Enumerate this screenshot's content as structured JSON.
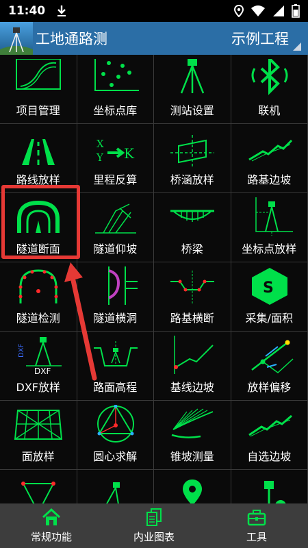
{
  "status": {
    "time": "11:40"
  },
  "appbar": {
    "title": "工地通路测",
    "project": "示例工程"
  },
  "grid": {
    "items": [
      {
        "label": "项目管理",
        "icon": "project-management-icon"
      },
      {
        "label": "坐标点库",
        "icon": "coordinate-points-icon"
      },
      {
        "label": "测站设置",
        "icon": "tripod-icon"
      },
      {
        "label": "联机",
        "icon": "bluetooth-icon"
      },
      {
        "label": "路线放样",
        "icon": "road-icon"
      },
      {
        "label": "里程反算",
        "icon": "xy-to-k-icon"
      },
      {
        "label": "桥涵放样",
        "icon": "culvert-icon"
      },
      {
        "label": "路基边坡",
        "icon": "slope-icon"
      },
      {
        "label": "隧道断面",
        "icon": "tunnel-section-icon"
      },
      {
        "label": "隧道仰坡",
        "icon": "tunnel-slope-icon"
      },
      {
        "label": "桥梁",
        "icon": "bridge-icon"
      },
      {
        "label": "坐标点放样",
        "icon": "point-stakeout-icon"
      },
      {
        "label": "隧道检测",
        "icon": "tunnel-check-icon"
      },
      {
        "label": "隧道横洞",
        "icon": "tunnel-cross-icon"
      },
      {
        "label": "路基横断",
        "icon": "roadbed-cross-icon"
      },
      {
        "label": "采集/面积",
        "icon": "collect-area-icon"
      },
      {
        "label": "DXF放样",
        "icon": "dxf-icon"
      },
      {
        "label": "路面高程",
        "icon": "elevation-icon"
      },
      {
        "label": "基线边坡",
        "icon": "baseline-slope-icon"
      },
      {
        "label": "放样偏移",
        "icon": "offset-icon"
      },
      {
        "label": "面放样",
        "icon": "surface-icon"
      },
      {
        "label": "圆心求解",
        "icon": "circle-center-icon"
      },
      {
        "label": "锥坡测量",
        "icon": "cone-slope-icon"
      },
      {
        "label": "自选边坡",
        "icon": "custom-slope-icon"
      },
      {
        "label": "",
        "icon": "triangle-net-icon"
      },
      {
        "label": "",
        "icon": "instrument-icon"
      },
      {
        "label": "",
        "icon": "map-pin-icon"
      },
      {
        "label": "",
        "icon": "gps-gear-icon"
      }
    ]
  },
  "nav": [
    {
      "label": "常规功能",
      "icon": "home-icon"
    },
    {
      "label": "内业图表",
      "icon": "documents-icon"
    },
    {
      "label": "工具",
      "icon": "toolbox-icon"
    }
  ],
  "colors": {
    "accent": "#00e04a",
    "appbar": "#2b6ea6",
    "highlight": "#e53935"
  }
}
